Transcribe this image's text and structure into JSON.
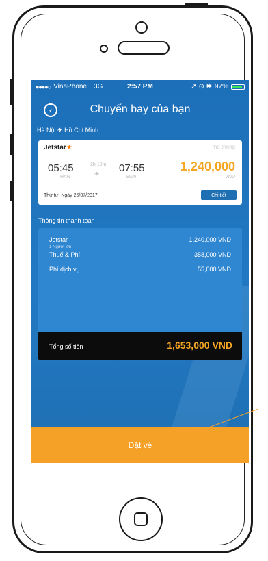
{
  "status_bar": {
    "signal": "●●●●○",
    "carrier": "VinaPhone",
    "network": "3G",
    "time": "2:57 PM",
    "indicators": "➚ ⊙ ✱",
    "battery": "97%"
  },
  "nav": {
    "back_icon": "chevron-left-circle-icon",
    "title": "Chuyến bay của bạn"
  },
  "route": {
    "from": "Hà Nội",
    "plane_icon": "✈",
    "to": "Hồ Chí Minh"
  },
  "flight_card": {
    "airline": "Jetstar",
    "airline_star": "★",
    "fare_class": "Phổ thông",
    "departure_time": "05:45",
    "departure_code": "HAN",
    "duration": "2h 10m",
    "arrival_time": "07:55",
    "arrival_code": "SGN",
    "price": "1,240,000",
    "currency": "VND",
    "date": "Thứ tư, Ngày 26/07/2017",
    "detail_label": "Chi tiết"
  },
  "payment": {
    "title": "Thông tin thanh toán",
    "rows": [
      {
        "label": "Jetstar",
        "value": "1,240,000 VND",
        "sub": "1 Người lớn"
      },
      {
        "label": "Thuế & Phí",
        "value": "358,000 VND"
      },
      {
        "label": "Phí dịch vụ",
        "value": "55,000 VND"
      }
    ],
    "total_label": "Tổng số tiền",
    "total_value": "1,653,000 VND"
  },
  "book_button": {
    "label": "Đặt vé"
  },
  "colors": {
    "primary": "#1f6fb3",
    "accent": "#f5a027",
    "price": "#f5a623"
  }
}
